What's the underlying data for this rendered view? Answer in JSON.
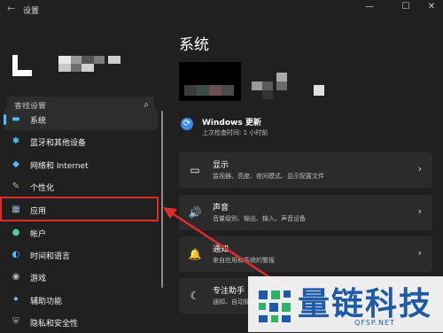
{
  "window": {
    "title": "设置",
    "back_icon": "←",
    "min_icon": "—",
    "max_icon": "☐",
    "close_icon": "✕"
  },
  "sidebar": {
    "search_placeholder": "查找设置",
    "search_icon": "⌕",
    "items": [
      {
        "label": "系统",
        "icon": "▬",
        "color": "#4cc2ff"
      },
      {
        "label": "蓝牙和其他设备",
        "icon": "✱",
        "color": "#4cc2ff"
      },
      {
        "label": "网络和 Internet",
        "icon": "◆",
        "color": "#4cc2ff"
      },
      {
        "label": "个性化",
        "icon": "✎",
        "color": "#d9a46a"
      },
      {
        "label": "应用",
        "icon": "▦",
        "color": "#9ab4d8"
      },
      {
        "label": "帐户",
        "icon": "●",
        "color": "#4fd18b"
      },
      {
        "label": "时间和语言",
        "icon": "◐",
        "color": "#4cc2ff"
      },
      {
        "label": "游戏",
        "icon": "◉",
        "color": "#bcbcbc"
      },
      {
        "label": "辅助功能",
        "icon": "✦",
        "color": "#7ec8ff"
      },
      {
        "label": "隐私和安全性",
        "icon": "⛨",
        "color": "#bcbcbc"
      }
    ]
  },
  "main": {
    "title": "系统",
    "update": {
      "title": "Windows 更新",
      "subtitle": "上次检查时间: 1 小时前",
      "icon": "⟳"
    },
    "cards": [
      {
        "title": "显示",
        "subtitle": "监视器、亮度、夜间模式、显示配置文件",
        "icon": "▭"
      },
      {
        "title": "声音",
        "subtitle": "音量级别、输出、输入、声音设备",
        "icon": "🔊"
      },
      {
        "title": "通知",
        "subtitle": "来自应用和系统的警报",
        "icon": "🔔"
      },
      {
        "title": "专注助手",
        "subtitle": "通知、自动规则",
        "icon": "☾"
      }
    ],
    "chevron": "›"
  },
  "watermark": {
    "text": "量链科技",
    "domain": "QFSP.NET"
  }
}
